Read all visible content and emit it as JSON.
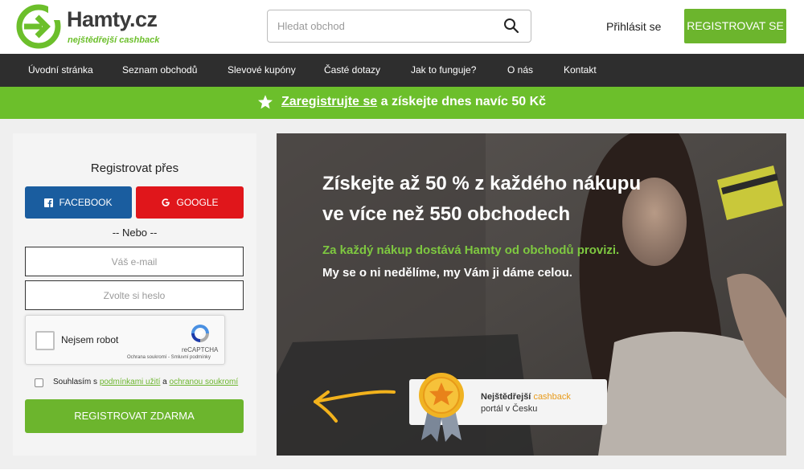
{
  "header": {
    "logo_name": "Hamty.cz",
    "logo_tagline": "nejštědřejší cashback",
    "search_placeholder": "Hledat obchod",
    "login_label": "Přihlásit se",
    "register_label": "REGISTROVAT SE"
  },
  "nav": {
    "items": [
      {
        "label": "Úvodní stránka"
      },
      {
        "label": "Seznam obchodů"
      },
      {
        "label": "Slevové kupóny"
      },
      {
        "label": "Časté dotazy"
      },
      {
        "label": "Jak to funguje?"
      },
      {
        "label": "O nás"
      },
      {
        "label": "Kontakt"
      }
    ]
  },
  "promo": {
    "link": "Zaregistrujte se",
    "rest": " a získejte dnes navíc 50 Kč"
  },
  "signup": {
    "title": "Registrovat přes",
    "facebook_label": "FACEBOOK",
    "google_label": "GOOGLE",
    "or_label": "-- Nebo --",
    "email_placeholder": "Váš e-mail",
    "password_placeholder": "Zvolte si heslo",
    "captcha_label": "Nejsem robot",
    "captcha_brand": "reCAPTCHA",
    "captcha_sub": "Ochrana soukromí - Smluvní podmínky",
    "agree_prefix": "Souhlasím s ",
    "agree_link1": "podmínkami užití",
    "agree_mid": " a ",
    "agree_link2": "ochranou soukromí",
    "submit_label": "REGISTROVAT ZDARMA"
  },
  "hero": {
    "title_line1": "Získejte až 50 % z každého nákupu",
    "title_line2": "ve více než 550 obchodech",
    "green_line": "Za každý nákup dostává Hamty od obchodů provizi.",
    "white_line": "My se o ni nedělíme, my Vám ji dáme celou.",
    "badge_bold": "Nejštědřejší",
    "badge_orange": "cashback",
    "badge_line2": "portál v Česku"
  },
  "colors": {
    "green": "#6cb52d",
    "nav_bg": "#2e2e2e",
    "facebook": "#1a5d9f",
    "google": "#e0161b"
  }
}
